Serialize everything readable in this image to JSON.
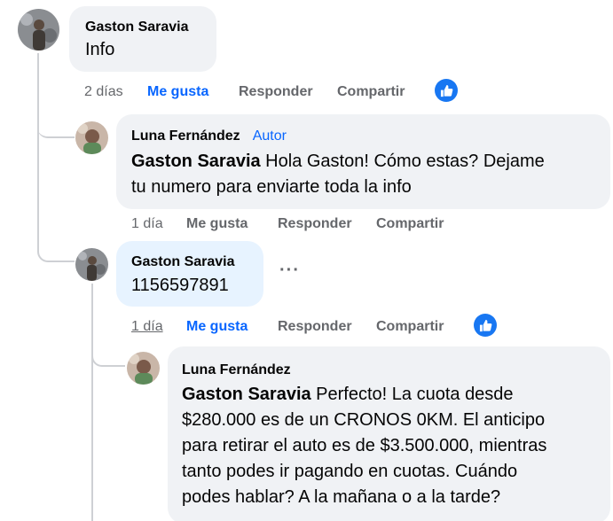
{
  "comments": [
    {
      "author": "Gaston Saravia",
      "text": "Info",
      "time": "2 días",
      "like_label": "Me gusta",
      "reply_label": "Responder",
      "share_label": "Compartir"
    },
    {
      "author": "Luna Fernández",
      "author_badge": "Autor",
      "mention": "Gaston Saravia",
      "text_line1": " Hola Gaston! Cómo estas? Dejame",
      "text_line2": "tu numero para enviarte toda la info",
      "time": "1 día",
      "like_label": "Me gusta",
      "reply_label": "Responder",
      "share_label": "Compartir"
    },
    {
      "author": "Gaston Saravia",
      "text": "1156597891",
      "more_options": "···",
      "time": "1 día",
      "like_label": "Me gusta",
      "reply_label": "Responder",
      "share_label": "Compartir"
    },
    {
      "author": "Luna Fernández",
      "mention": "Gaston Saravia",
      "text_line1": " Perfecto! La cuota desde",
      "text_line2": "$280.000 es de un CRONOS 0KM. El anticipo",
      "text_line3": "para retirar el auto es de $3.500.000, mientras",
      "text_line4": "tanto podes ir pagando en cuotas. Cuándo",
      "text_line5": "podes hablar? A la mañana o a la tarde?"
    }
  ],
  "colors": {
    "link_blue": "#0866ff",
    "bubble_gray": "#f0f2f5",
    "bubble_selected": "#e7f3ff",
    "meta_gray": "#65676b",
    "thread_line": "#ced0d4"
  },
  "icons": [
    "avatar-gaston",
    "avatar-luna",
    "thumbs-up-icon",
    "more-options-icon"
  ]
}
